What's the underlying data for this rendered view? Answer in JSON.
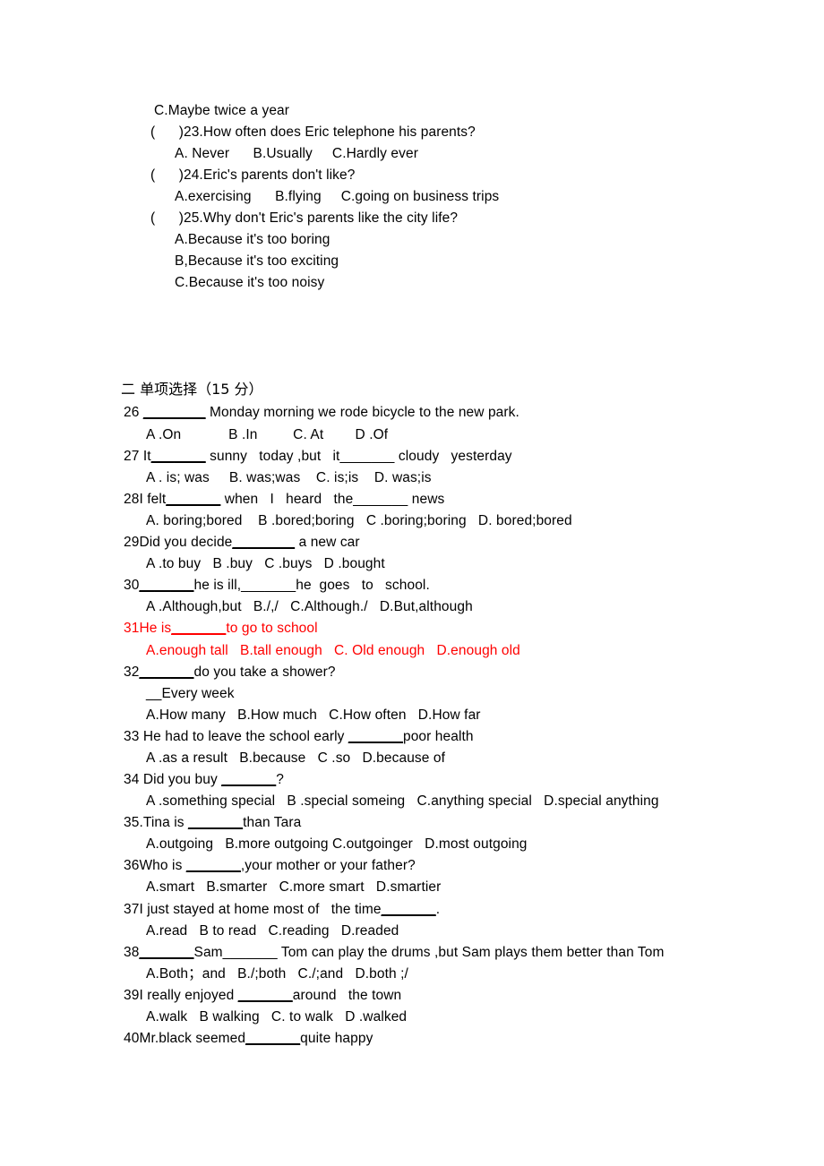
{
  "document": {
    "type": "english-exam-worksheet",
    "colors": {
      "text": "#000000",
      "highlight": "#ff0000",
      "background": "#ffffff"
    }
  },
  "listening_section": {
    "stray_option": "C.Maybe twice a year",
    "questions": [
      {
        "marker": "（　）",
        "bracket_open": "(",
        "bracket_close": ")",
        "number": "23.",
        "stem": "How often does Eric telephone his parents?",
        "options_line": "A. Never      B.Usually     C.Hardly ever"
      },
      {
        "bracket_open": "(",
        "bracket_close": ")",
        "number": "24.",
        "stem": "Eric's parents don't like?",
        "options_line": "A.exercising      B.flying     C.going on business trips"
      },
      {
        "bracket_open": "(",
        "bracket_close": ")",
        "number": "25.",
        "stem": "Why don't Eric's parents like the city life?",
        "options_stacked": [
          "A.Because it's too boring",
          "B,Because it's too exciting",
          "C.Because it's too noisy"
        ]
      }
    ]
  },
  "section_two": {
    "heading": "二 单项选择（15 分）",
    "questions": [
      {
        "id": "q26",
        "number": "26",
        "stem_before": " ",
        "blank": "________",
        "stem_after": " Monday morning we rode bicycle to the new park.",
        "options": "A .On            B .In         C. At        D .Of",
        "color": "black"
      },
      {
        "id": "q27",
        "number": "27",
        "stem_before": " It",
        "blank": "_______",
        "stem_after": " sunny   today ,but   it_______ cloudy   yesterday",
        "options": "A . is; was     B. was;was    C. is;is    D. was;is",
        "color": "black"
      },
      {
        "id": "q28",
        "number": "28",
        "stem_before": "I felt",
        "blank": "_______",
        "stem_after": " when   I   heard   the_______ news",
        "options": "A. boring;bored    B .bored;boring   C .boring;boring   D. bored;bored",
        "color": "black"
      },
      {
        "id": "q29",
        "number": "29",
        "stem_before": "Did you decide",
        "blank": "________",
        "stem_after": " a new car",
        "options": "A .to buy   B .buy   C .buys   D .bought",
        "color": "black"
      },
      {
        "id": "q30",
        "number": "30",
        "stem_before": "",
        "blank": "_______",
        "stem_after": "he is ill,_______he  goes   to   school.",
        "options": "A .Although,but   B./,/   C.Although./   D.But,although",
        "color": "black"
      },
      {
        "id": "q31",
        "number": "31",
        "stem_before": "He is",
        "blank": "_______",
        "stem_after": "to go to school",
        "options": "A.enough tall   B.tall enough   C. Old enough   D.enough old",
        "color": "red"
      },
      {
        "id": "q32",
        "number": "32",
        "stem_before": "",
        "blank": "_______",
        "stem_after": "do you take a shower?",
        "answer_line": "__Every week",
        "options": "A.How many   B.How much   C.How often   D.How far",
        "color": "black"
      },
      {
        "id": "q33",
        "number": "33",
        "stem_before": " He had to leave the school early ",
        "blank": "_______",
        "stem_after": "poor health",
        "options": "A .as a result   B.because   C .so   D.because of",
        "color": "black"
      },
      {
        "id": "q34",
        "number": "34",
        "stem_before": " Did you buy ",
        "blank": "_______",
        "stem_after": "?",
        "options": "A .something special   B .special someing   C.anything special   D.special anything",
        "color": "black"
      },
      {
        "id": "q35",
        "number": "35.",
        "stem_before": "Tina is ",
        "blank": "_______",
        "stem_after": "than Tara",
        "options": "A.outgoing   B.more outgoing C.outgoinger   D.most outgoing",
        "color": "black"
      },
      {
        "id": "q36",
        "number": "36",
        "stem_before": "Who is ",
        "blank": "_______",
        "stem_after": ",your mother or your father?",
        "options": "A.smart   B.smarter   C.more smart   D.smartier",
        "color": "black"
      },
      {
        "id": "q37",
        "number": "37",
        "stem_before": "I just stayed at home most of   the time",
        "blank": "_______",
        "stem_after": ".",
        "options": "A.read   B to read   C.reading   D.readed",
        "color": "black"
      },
      {
        "id": "q38",
        "number": "38",
        "stem_before": "",
        "blank": "_______",
        "stem_after": "Sam_______ Tom can play the drums ,but Sam plays them better than Tom",
        "options": "A.Both；and   B./;both   C./;and   D.both ;/",
        "color": "black"
      },
      {
        "id": "q39",
        "number": "39",
        "stem_before": "I really enjoyed ",
        "blank": "_______",
        "stem_after": "around   the town",
        "options": "A.walk   B walking   C. to walk   D .walked",
        "color": "black"
      },
      {
        "id": "q40",
        "number": "40",
        "stem_before": "Mr.black seemed",
        "blank": "_______",
        "stem_after": "quite happy",
        "options": "",
        "color": "black"
      }
    ]
  }
}
